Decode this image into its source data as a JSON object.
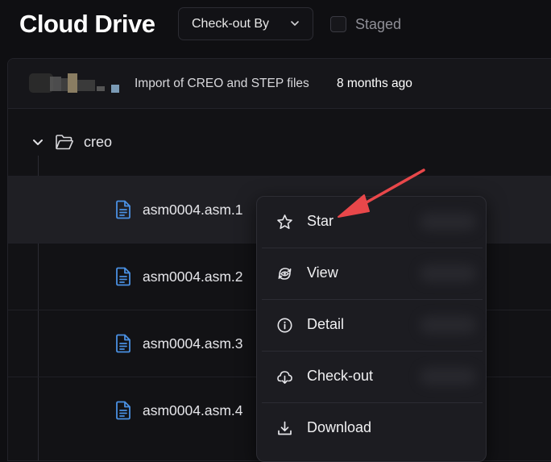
{
  "header": {
    "title": "Cloud Drive",
    "checkout_filter": {
      "label": "Check-out By"
    },
    "staged": {
      "label": "Staged",
      "checked": false
    }
  },
  "commit": {
    "message": "Import of CREO and STEP files",
    "time": "8 months ago"
  },
  "folder": {
    "name": "creo",
    "expanded": true,
    "icon": "folder-open-icon"
  },
  "files": [
    {
      "name": "asm0004.asm.1",
      "icon": "document-icon"
    },
    {
      "name": "asm0004.asm.2",
      "icon": "document-icon"
    },
    {
      "name": "asm0004.asm.3",
      "icon": "document-icon"
    },
    {
      "name": "asm0004.asm.4",
      "icon": "document-icon"
    }
  ],
  "context_menu": {
    "items": [
      {
        "label": "Star",
        "icon": "star-icon"
      },
      {
        "label": "View",
        "icon": "view-icon"
      },
      {
        "label": "Detail",
        "icon": "info-icon"
      },
      {
        "label": "Check-out",
        "icon": "cloud-download-icon"
      },
      {
        "label": "Download",
        "icon": "download-icon"
      }
    ]
  },
  "colors": {
    "background": "#0f0f12",
    "file_icon": "#4a90e2",
    "annotation_arrow": "#e8474a"
  }
}
